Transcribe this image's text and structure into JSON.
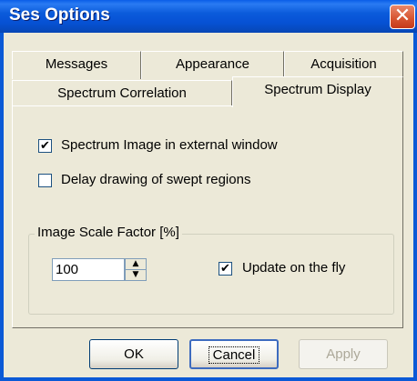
{
  "window": {
    "title": "Ses Options",
    "close_glyph": "✕"
  },
  "tabs_row1": [
    {
      "label": "Messages"
    },
    {
      "label": "Appearance"
    },
    {
      "label": "Acquisition"
    }
  ],
  "tabs_row2": [
    {
      "label": "Spectrum Correlation"
    },
    {
      "label": "Spectrum Display",
      "selected": true
    }
  ],
  "options": {
    "external_window": {
      "label": "Spectrum Image in external window",
      "checked": true
    },
    "delay_drawing": {
      "label": "Delay drawing of swept regions",
      "checked": false
    }
  },
  "scale_group": {
    "label": "Image Scale Factor [%]",
    "value": "100",
    "update_on_fly": {
      "label": "Update on the fly",
      "checked": true
    }
  },
  "buttons": {
    "ok": "OK",
    "cancel": "Cancel",
    "apply": "Apply"
  },
  "check_glyph": "✔",
  "icons": {
    "close": "close-icon",
    "spin_up": "▲",
    "spin_down": "▼"
  }
}
